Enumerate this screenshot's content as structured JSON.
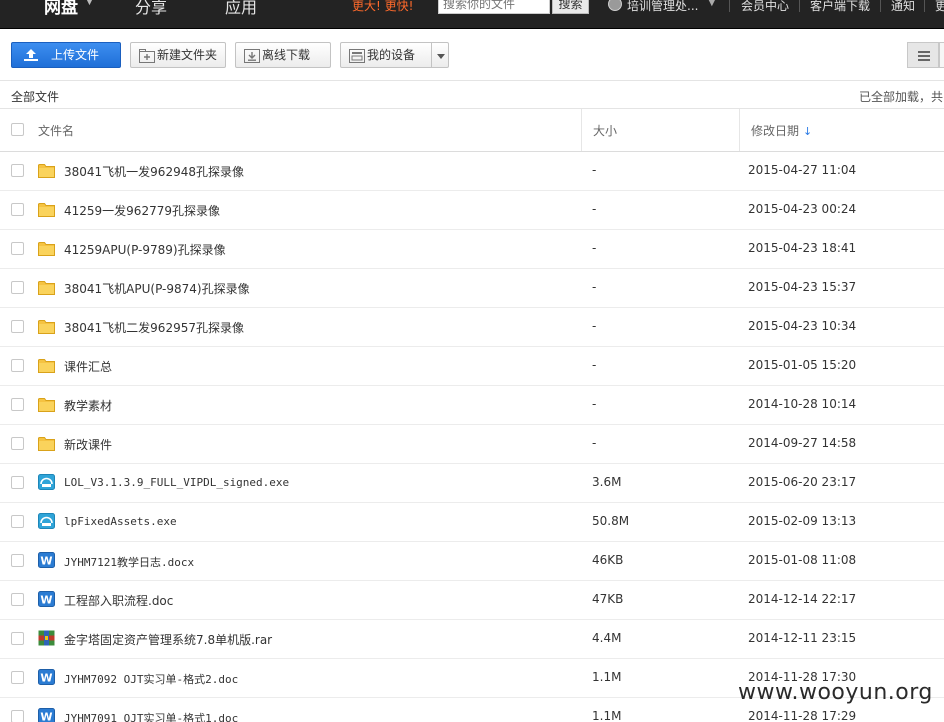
{
  "nav": {
    "brand": "网盘",
    "items": [
      "分享",
      "应用"
    ],
    "promo": "更大! 更快!",
    "search_placeholder": "搜索你的文件",
    "search_button": "搜索",
    "user_name": "培训管理处...",
    "links": [
      "会员中心",
      "客户端下载",
      "通知",
      "更"
    ]
  },
  "toolbar": {
    "upload": "上传文件",
    "new_folder": "新建文件夹",
    "offline_download": "离线下载",
    "my_devices": "我的设备"
  },
  "breadcrumb": {
    "path": "全部文件",
    "status": "已全部加载，共"
  },
  "columns": {
    "name": "文件名",
    "size": "大小",
    "date": "修改日期"
  },
  "files": [
    {
      "name": "38041飞机一发962948孔探录像",
      "size": "-",
      "date": "2015-04-27 11:04",
      "type": "folder"
    },
    {
      "name": "41259一发962779孔探录像",
      "size": "-",
      "date": "2015-04-23 00:24",
      "type": "folder"
    },
    {
      "name": "41259APU(P-9789)孔探录像",
      "size": "-",
      "date": "2015-04-23 18:41",
      "type": "folder"
    },
    {
      "name": "38041飞机APU(P-9874)孔探录像",
      "size": "-",
      "date": "2015-04-23 15:37",
      "type": "folder"
    },
    {
      "name": "38041飞机二发962957孔探录像",
      "size": "-",
      "date": "2015-04-23 10:34",
      "type": "folder"
    },
    {
      "name": "课件汇总",
      "size": "-",
      "date": "2015-01-05 15:20",
      "type": "folder"
    },
    {
      "name": "教学素材",
      "size": "-",
      "date": "2014-10-28 10:14",
      "type": "folder"
    },
    {
      "name": "新改课件",
      "size": "-",
      "date": "2014-09-27 14:58",
      "type": "folder"
    },
    {
      "name": "LOL_V3.1.3.9_FULL_VIPDL_signed.exe",
      "size": "3.6M",
      "date": "2015-06-20 23:17",
      "type": "exe"
    },
    {
      "name": "lpFixedAssets.exe",
      "size": "50.8M",
      "date": "2015-02-09 13:13",
      "type": "exe"
    },
    {
      "name": "JYHM7121教学日志.docx",
      "size": "46KB",
      "date": "2015-01-08 11:08",
      "type": "word"
    },
    {
      "name": "工程部入职流程.doc",
      "size": "47KB",
      "date": "2014-12-14 22:17",
      "type": "word"
    },
    {
      "name": "金字塔固定资产管理系统7.8单机版.rar",
      "size": "4.4M",
      "date": "2014-12-11 23:15",
      "type": "rar"
    },
    {
      "name": "JYHM7092 OJT实习单-格式2.doc",
      "size": "1.1M",
      "date": "2014-11-28 17:30",
      "type": "word"
    },
    {
      "name": "JYHM7091 OJT实习单-格式1.doc",
      "size": "1.1M",
      "date": "2014-11-28 17:29",
      "type": "word"
    }
  ],
  "colors": {
    "topbar": "#232323",
    "upload_button": "#1f6fd8",
    "promo": "#ff6a2b",
    "folder": "#f5c342",
    "word_icon": "#2b7cd3"
  },
  "watermark": "www.wooyun.org"
}
